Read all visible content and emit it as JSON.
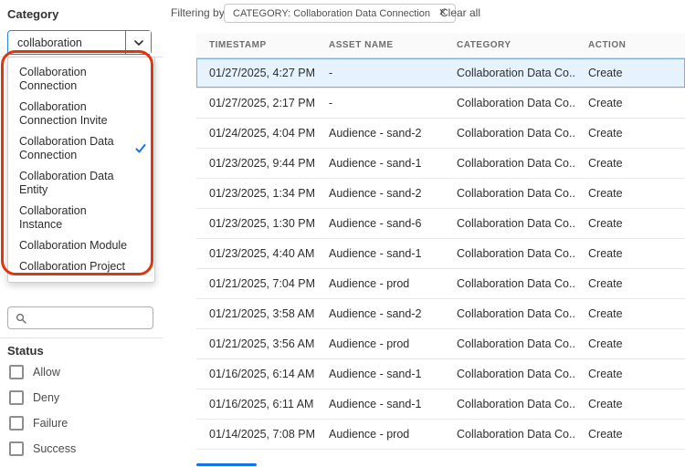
{
  "colors": {
    "accent": "#1473e6",
    "annotation_red": "#e1350e",
    "selected_row_bg": "#e6f2fd"
  },
  "icons": {
    "combobox_button": "chevron-down",
    "sidebar_search": "magnifier",
    "selected_dropdown_item": "checkmark",
    "filter_tag_close": "x"
  },
  "sidebar": {
    "category_label": "Category",
    "category_input": {
      "value": "collaboration"
    },
    "dropdown": {
      "items": [
        {
          "label": "Collaboration Connection",
          "selected": false
        },
        {
          "label": "Collaboration Connection Invite",
          "selected": false
        },
        {
          "label": "Collaboration Data Connection",
          "selected": true
        },
        {
          "label": "Collaboration Data Entity",
          "selected": false
        },
        {
          "label": "Collaboration Instance",
          "selected": false
        },
        {
          "label": "Collaboration Module",
          "selected": false
        },
        {
          "label": "Collaboration Project",
          "selected": false
        }
      ]
    },
    "search": {
      "placeholder": ""
    },
    "status": {
      "label": "Status",
      "options": [
        "Allow",
        "Deny",
        "Failure",
        "Success"
      ]
    }
  },
  "main": {
    "filter_bar": {
      "filtering_by_label": "Filtering by",
      "filter_tag": "CATEGORY: Collaboration Data Connection",
      "remove_symbol": "✕",
      "clear_all_label": "Clear all"
    },
    "table": {
      "columns": [
        "TIMESTAMP",
        "ASSET NAME",
        "CATEGORY",
        "ACTION"
      ],
      "rows": [
        {
          "timestamp": "01/27/2025, 4:27 PM",
          "asset": "-",
          "category": "Collaboration Data Co...",
          "action": "Create",
          "selected": true
        },
        {
          "timestamp": "01/27/2025, 2:17 PM",
          "asset": "-",
          "category": "Collaboration Data Co...",
          "action": "Create",
          "selected": false
        },
        {
          "timestamp": "01/24/2025, 4:04 PM",
          "asset": "Audience - sand-2",
          "category": "Collaboration Data Co...",
          "action": "Create",
          "selected": false
        },
        {
          "timestamp": "01/23/2025, 9:44 PM",
          "asset": "Audience - sand-1",
          "category": "Collaboration Data Co...",
          "action": "Create",
          "selected": false
        },
        {
          "timestamp": "01/23/2025, 1:34 PM",
          "asset": "Audience - sand-2",
          "category": "Collaboration Data Co...",
          "action": "Create",
          "selected": false
        },
        {
          "timestamp": "01/23/2025, 1:30 PM",
          "asset": "Audience - sand-6",
          "category": "Collaboration Data Co...",
          "action": "Create",
          "selected": false
        },
        {
          "timestamp": "01/23/2025, 4:40 AM",
          "asset": "Audience - sand-1",
          "category": "Collaboration Data Co...",
          "action": "Create",
          "selected": false
        },
        {
          "timestamp": "01/21/2025, 7:04 PM",
          "asset": "Audience - prod",
          "category": "Collaboration Data Co...",
          "action": "Create",
          "selected": false
        },
        {
          "timestamp": "01/21/2025, 3:58 AM",
          "asset": "Audience - sand-2",
          "category": "Collaboration Data Co...",
          "action": "Create",
          "selected": false
        },
        {
          "timestamp": "01/21/2025, 3:56 AM",
          "asset": "Audience - prod",
          "category": "Collaboration Data Co...",
          "action": "Create",
          "selected": false
        },
        {
          "timestamp": "01/16/2025, 6:14 AM",
          "asset": "Audience - sand-1",
          "category": "Collaboration Data Co...",
          "action": "Create",
          "selected": false
        },
        {
          "timestamp": "01/16/2025, 6:11 AM",
          "asset": "Audience - sand-1",
          "category": "Collaboration Data Co...",
          "action": "Create",
          "selected": false
        },
        {
          "timestamp": "01/14/2025, 7:08 PM",
          "asset": "Audience - prod",
          "category": "Collaboration Data Co...",
          "action": "Create",
          "selected": false
        }
      ]
    }
  }
}
